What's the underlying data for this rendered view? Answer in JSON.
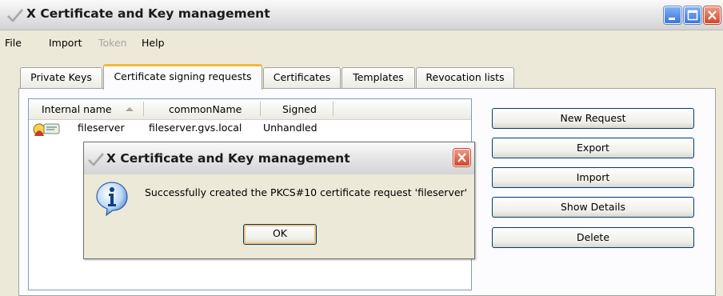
{
  "window": {
    "title": "X Certificate and Key management"
  },
  "menu": {
    "items": [
      {
        "label": "File",
        "enabled": true
      },
      {
        "label": "Import",
        "enabled": true
      },
      {
        "label": "Token",
        "enabled": false
      },
      {
        "label": "Help",
        "enabled": true
      }
    ]
  },
  "tabs": [
    {
      "label": "Private Keys",
      "active": false
    },
    {
      "label": "Certificate signing requests",
      "active": true
    },
    {
      "label": "Certificates",
      "active": false
    },
    {
      "label": "Templates",
      "active": false
    },
    {
      "label": "Revocation lists",
      "active": false
    }
  ],
  "list": {
    "columns": [
      "Internal name",
      "commonName",
      "Signed"
    ],
    "sort_column": "Internal name",
    "rows": [
      {
        "internal_name": "fileserver",
        "common_name": "fileserver.gvs.local",
        "signed": "Unhandled",
        "icon": "certificate-request-icon"
      }
    ]
  },
  "side_buttons": {
    "new_request": "New Request",
    "export": "Export",
    "import": "Import",
    "show_details": "Show Details",
    "delete": "Delete"
  },
  "dialog": {
    "title": "X Certificate and Key management",
    "message": "Successfully created the PKCS#10 certificate request 'fileserver'",
    "ok_label": "OK",
    "icon": "info-icon"
  },
  "colors": {
    "active_tab_accent": "#f7b73b",
    "button_border": "#003c74",
    "close_button": "#d2452a"
  }
}
